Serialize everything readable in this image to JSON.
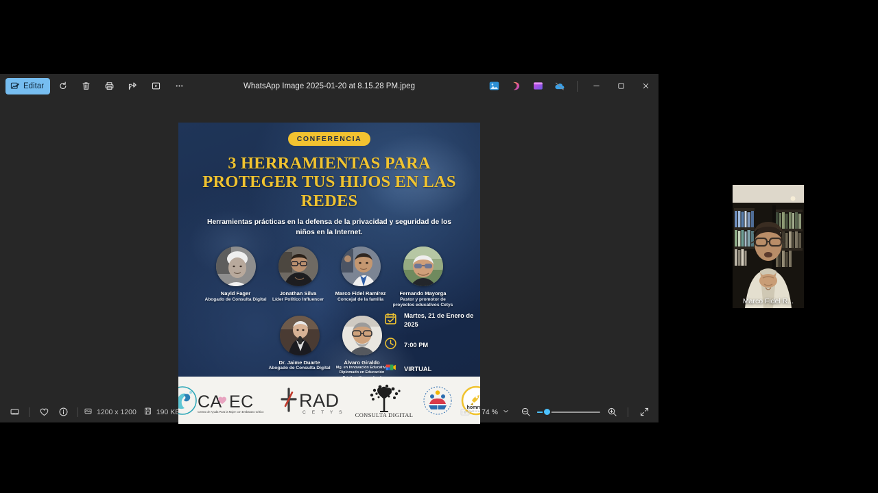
{
  "window": {
    "title": "WhatsApp Image 2025-01-20 at 8.15.28 PM.jpeg",
    "edit_label": "Editar",
    "toolbar": [
      {
        "name": "rotate-icon",
        "label": "Girar"
      },
      {
        "name": "delete-icon",
        "label": "Eliminar"
      },
      {
        "name": "print-icon",
        "label": "Imprimir"
      },
      {
        "name": "share-icon",
        "label": "Compartir"
      },
      {
        "name": "slideshow-icon",
        "label": "Presentación"
      },
      {
        "name": "more-icon",
        "label": "Ver más"
      }
    ],
    "app_icons": [
      {
        "name": "photos-app-icon",
        "label": "Fotos"
      },
      {
        "name": "designer-app-icon",
        "label": "Designer"
      },
      {
        "name": "clipchamp-app-icon",
        "label": "Clipchamp"
      },
      {
        "name": "onedrive-offline-icon",
        "label": "OneDrive"
      }
    ],
    "controls": {
      "minimize": "—",
      "maximize": "❐",
      "close": "✕"
    }
  },
  "statusbar": {
    "filmstrip_label": "Tira de película",
    "favorite_label": "Favorito",
    "info_label": "Información del archivo",
    "dimensions": "1200 x 1200",
    "filesize": "190 KB",
    "fit_label": "Ajustar al tamaño",
    "actual_size_label": "Tamaño real",
    "zoom_level": "74 %",
    "zoom_out_label": "Alejar",
    "zoom_in_label": "Acercar",
    "fullscreen_label": "Pantalla completa"
  },
  "poster": {
    "badge": "CONFERENCIA",
    "title": "3 HERRAMIENTAS PARA PROTEGER TUS HIJOS EN LAS REDES",
    "subtitle": "Herramientas prácticas en la defensa de la privacidad y seguridad de los niños en la Internet.",
    "accent_color": "#f0c330",
    "background_color": "#1b2e4f",
    "speakers_row1": [
      {
        "name": "Nayid Fager",
        "role": "Abogado de Consulta Digital"
      },
      {
        "name": "Jonathan Silva",
        "role": "Líder Político Influencer"
      },
      {
        "name": "Marco Fidel Ramírez",
        "role": "Concejal de la familia"
      },
      {
        "name": "Fernando Mayorga",
        "role": "Pastor y promotor de proyectos educativos Cetys"
      }
    ],
    "speakers_row2": [
      {
        "name": "Dr. Jaime Duarte",
        "role": "Abogado de Consulta Digital"
      },
      {
        "name": "Álvaro Giraldo",
        "role": "Mg. en Innovación Educativa Diplomado en Educación CristianaHomeschool"
      }
    ],
    "details": [
      {
        "icon": "calendar-check-icon",
        "text": "Martes, 21 de Enero de 2025"
      },
      {
        "icon": "clock-icon",
        "text": "7:00 PM"
      },
      {
        "icon": "google-meet-icon",
        "text": "VIRTUAL"
      }
    ],
    "logos": [
      {
        "name": "camec-logo",
        "text": "CA EC",
        "subtext": "Centro de Ayuda Para la Mujer con Embarazo Crítico"
      },
      {
        "name": "rad-cetys-logo",
        "text": "RAD",
        "subtext": "C E T Y S"
      },
      {
        "name": "consulta-digital-logo",
        "text": "CONSULTA DIGITAL",
        "subtext": ""
      },
      {
        "name": "foundation-logo",
        "text": "",
        "subtext": ""
      },
      {
        "name": "hommik-logo",
        "text": "hommik",
        "subtext": "HOMESCHOOL"
      }
    ]
  },
  "video": {
    "participant_name": "Marco Fidel R..."
  }
}
